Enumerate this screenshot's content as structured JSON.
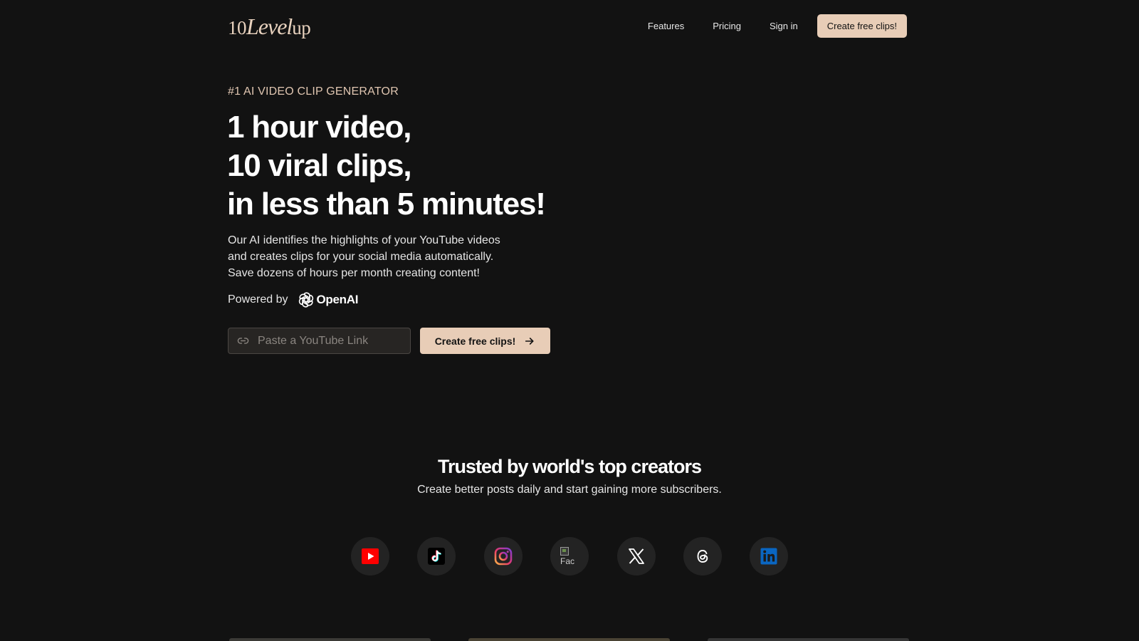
{
  "nav": {
    "logo": {
      "prefix": "10",
      "level": "Level",
      "suffix": "up"
    },
    "links": [
      "Features",
      "Pricing",
      "Sign in"
    ],
    "cta": "Create free clips!"
  },
  "hero": {
    "eyebrow": "#1 AI VIDEO CLIP GENERATOR",
    "headline": [
      "1 hour video,",
      "10 viral clips,",
      "in less than 5 minutes!"
    ],
    "description": [
      "Our AI identifies the highlights of your YouTube videos",
      "and creates clips for your social media automatically.",
      "Save dozens of hours per month creating content!"
    ],
    "powered_by": "Powered by",
    "powered_brand": "OpenAI",
    "input": {
      "placeholder": "Paste a YouTube Link",
      "value": ""
    },
    "cta": "Create free clips!"
  },
  "trusted": {
    "title": "Trusted by world's top creators",
    "subtitle": "Create better posts daily and start gaining more subscribers."
  },
  "socials": [
    {
      "name": "youtube-icon"
    },
    {
      "name": "tiktok-icon"
    },
    {
      "name": "instagram-icon"
    },
    {
      "name": "facebook-icon",
      "alt": "Fac"
    },
    {
      "name": "x-icon"
    },
    {
      "name": "threads-icon"
    },
    {
      "name": "linkedin-icon"
    }
  ],
  "colors": {
    "background": "#121212",
    "accent": "#e8cdb7",
    "eyebrow": "#e0c6b1",
    "social_bg": "#232323"
  }
}
